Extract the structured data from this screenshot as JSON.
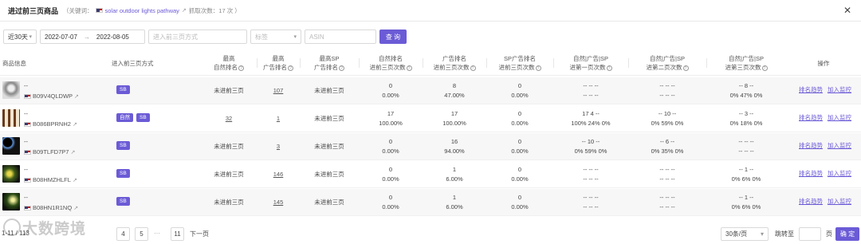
{
  "header": {
    "title": "进过前三页商品",
    "keyword_prefix": "（关键词：",
    "keyword": "solar outdoor lights pathway",
    "crawl_text": "抓取次数：17 次 ）",
    "close_icon": "close-icon"
  },
  "filters": {
    "period": "近30天",
    "date_start": "2022-07-07",
    "date_arrow": "→",
    "date_end": "2022-08-05",
    "method_placeholder": "进入前三页方式",
    "label_placeholder": "标签",
    "asin_placeholder": "ASIN",
    "search_label": "查 询"
  },
  "columns": {
    "product": "商品信息",
    "method": "进入前三页方式",
    "best_natural": [
      "最高",
      "自然排名"
    ],
    "best_ad": [
      "最高",
      "广告排名"
    ],
    "best_sp": [
      "最高SP",
      "广告排名"
    ],
    "natural_count": [
      "自然排名",
      "进前三页次数"
    ],
    "ad_count": [
      "广告排名",
      "进前三页次数"
    ],
    "sp_count": [
      "SP广告排名",
      "进前三页次数"
    ],
    "p1": [
      "自然|广告|SP",
      "进第一页次数"
    ],
    "p2": [
      "自然|广告|SP",
      "进第二页次数"
    ],
    "p3": [
      "自然|广告|SP",
      "进第三页次数"
    ],
    "ops": "操作"
  },
  "rows": [
    {
      "name": "--",
      "asin": "B09V4QLDWP",
      "tags": [
        "SB"
      ],
      "best_natural": "未进前三页",
      "best_ad": "107",
      "best_sp": "未进前三页",
      "natural_count": "0",
      "natural_pct": "0.00%",
      "ad_count": "8",
      "ad_pct": "47.00%",
      "sp_count": "0",
      "sp_pct": "0.00%",
      "p1_a": "-- -- --",
      "p1_b": "-- -- --",
      "p2_a": "-- -- --",
      "p2_b": "-- -- --",
      "p3_a": "-- 8 --",
      "p3_b": "0% 47% 0%",
      "op1": "排名趋势",
      "op2": "加入监控"
    },
    {
      "name": "--",
      "asin": "B086BPRNH2",
      "tags": [
        "自然",
        "SB"
      ],
      "best_natural": "32",
      "best_ad": "1",
      "best_sp": "未进前三页",
      "natural_count": "17",
      "natural_pct": "100.00%",
      "ad_count": "17",
      "ad_pct": "100.00%",
      "sp_count": "0",
      "sp_pct": "0.00%",
      "p1_a": "17 4 --",
      "p1_b": "100% 24% 0%",
      "p2_a": "-- 10 --",
      "p2_b": "0% 59% 0%",
      "p3_a": "-- 3 --",
      "p3_b": "0% 18% 0%",
      "op1": "排名趋势",
      "op2": "加入监控"
    },
    {
      "name": "--",
      "asin": "B09TLFD7P7",
      "tags": [
        "SB"
      ],
      "best_natural": "未进前三页",
      "best_ad": "3",
      "best_sp": "未进前三页",
      "natural_count": "0",
      "natural_pct": "0.00%",
      "ad_count": "16",
      "ad_pct": "94.00%",
      "sp_count": "0",
      "sp_pct": "0.00%",
      "p1_a": "-- 10 --",
      "p1_b": "0% 59% 0%",
      "p2_a": "-- 6 --",
      "p2_b": "0% 35% 0%",
      "p3_a": "-- -- --",
      "p3_b": "-- -- --",
      "op1": "排名趋势",
      "op2": "加入监控"
    },
    {
      "name": "--",
      "asin": "B08HMZHLFL",
      "tags": [
        "SB"
      ],
      "best_natural": "未进前三页",
      "best_ad": "146",
      "best_sp": "未进前三页",
      "natural_count": "0",
      "natural_pct": "0.00%",
      "ad_count": "1",
      "ad_pct": "6.00%",
      "sp_count": "0",
      "sp_pct": "0.00%",
      "p1_a": "-- -- --",
      "p1_b": "-- -- --",
      "p2_a": "-- -- --",
      "p2_b": "-- -- --",
      "p3_a": "-- 1 --",
      "p3_b": "0% 6% 0%",
      "op1": "排名趋势",
      "op2": "加入监控"
    },
    {
      "name": "--",
      "asin": "B08HN1R1NQ",
      "tags": [
        "SB"
      ],
      "best_natural": "未进前三页",
      "best_ad": "145",
      "best_sp": "未进前三页",
      "natural_count": "0",
      "natural_pct": "0.00%",
      "ad_count": "1",
      "ad_pct": "6.00%",
      "sp_count": "0",
      "sp_pct": "0.00%",
      "p1_a": "-- -- --",
      "p1_b": "-- -- --",
      "p2_a": "-- -- --",
      "p2_b": "-- -- --",
      "p3_a": "-- 1 --",
      "p3_b": "0% 6% 0%",
      "op1": "排名趋势",
      "op2": "加入监控"
    }
  ],
  "pagination": {
    "total": "1-11 / 113",
    "page4": "4",
    "page5": "5",
    "ellipsis": "···",
    "page11": "11",
    "next": "下一页",
    "page_size": "30条/页",
    "jump_label": "跳转至",
    "page_unit": "页",
    "confirm": "确 定"
  },
  "watermark": "大数跨境",
  "colors": {
    "accent": "#6b5bd6"
  }
}
